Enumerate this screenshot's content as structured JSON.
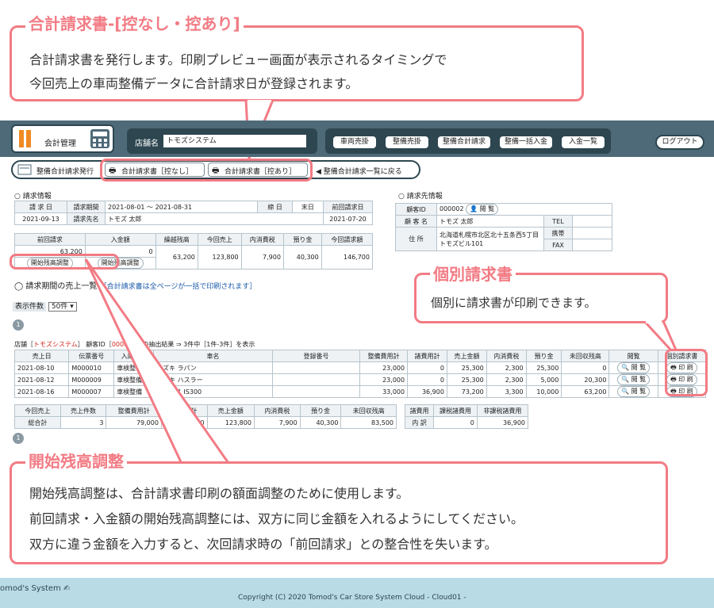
{
  "callout_top": {
    "title": "合計請求書-[控なし・控あり]",
    "line1": "合計請求書を発行します。印刷プレビュー画面が表示されるタイミングで",
    "line2": "今回売上の車両整備データに合計請求日が登録されます。"
  },
  "callout_mid": {
    "title": "個別請求書",
    "line1": "個別に請求書が印刷できます。"
  },
  "callout_bottom": {
    "title": "開始残高調整",
    "line1": "開始残高調整は、合計請求書印刷の額面調整のために使用します。",
    "line2": "前回請求・入金額の開始残高調整には、双方に同じ金額を入れるようにしてください。",
    "line3": "双方に違う金額を入力すると、次回請求時の「前回請求」との整合性を失います。"
  },
  "header": {
    "app_label": "会計管理",
    "store_label": "店舗名",
    "store_value": "トモズシステム",
    "nav": [
      "車両売掛",
      "整備売掛",
      "整備合計請求",
      "整備一括入金",
      "入金一覧"
    ],
    "logout": "ログアウト"
  },
  "toolbar": {
    "issue": "整備合計請求発行",
    "print_no_copy": "合計請求書［控なし］",
    "print_with_copy": "合計請求書［控あり］",
    "back": "整備合計請求一覧に戻る"
  },
  "billing": {
    "section": "請求情報",
    "h_date": "請 求 日",
    "date": "2021-09-13",
    "h_period": "請求期間",
    "period": "2021-08-01 ～ 2021-08-31",
    "h_cutoff": "締 日",
    "cutoff": "末日",
    "h_customer": "請求先名",
    "customer": "トモズ 太郎",
    "h_prev_date": "前回請求日",
    "prev_date": "2021-07-20",
    "sum_headers": [
      "前回請求",
      "入金額",
      "繰越残高",
      "今回売上",
      "内消費税",
      "預り金",
      "今回請求額"
    ],
    "prev_bill": "63,200",
    "deposit": "0",
    "carry": "63,200",
    "sales": "123,800",
    "tax": "7,900",
    "held": "40,300",
    "bill_total": "146,700",
    "adjust1": "開始残高調整",
    "adjust2": "開始残高調整"
  },
  "dest": {
    "section": "請求先情報",
    "h_id": "顧客ID",
    "id": "000002",
    "view": "閲 覧",
    "h_name": "顧 客 名",
    "name": "トモズ 太郎",
    "h_addr": "住 所",
    "addr1": "北海道札幌市北区北十五条西5丁目",
    "addr2": "トモズビル101",
    "tel": "TEL",
    "mobile": "携帯",
    "fax": "FAX"
  },
  "list": {
    "title": "請求期間の売上一覧",
    "note": "［合計請求書は全ページが一括で印刷されます］",
    "count_label": "表示件数",
    "count_value": "50件",
    "page": "1",
    "filter_prefix": "店舗［",
    "filter_store": "トモズシステム",
    "filter_mid": "］ 顧客ID［",
    "filter_id": "000002",
    "filter_suffix": "］の抽出結果 ⇒ 3件中［1件-3件］を表示",
    "headers": [
      "売上日",
      "伝票番号",
      "入庫区分",
      "車名",
      "登録番号",
      "整備費用計",
      "諸費用計",
      "売上金額",
      "内消費税",
      "預り金",
      "未回収残高",
      "閲覧",
      "個別請求書"
    ],
    "view_label": "閲 覧",
    "print_label": "印 刷",
    "rows": [
      {
        "date": "2021-08-10",
        "no": "M000010",
        "kind": "車検整備",
        "car": "スズキ ラパン",
        "reg": "",
        "maint": "23,000",
        "misc": "0",
        "sales": "25,300",
        "tax": "2,300",
        "held": "25,300",
        "unpaid": "0"
      },
      {
        "date": "2021-08-12",
        "no": "M000009",
        "kind": "車検整備",
        "car": "スズキ ハスラー",
        "reg": "",
        "maint": "23,000",
        "misc": "0",
        "sales": "25,300",
        "tax": "2,300",
        "held": "5,000",
        "unpaid": "20,300"
      },
      {
        "date": "2021-08-16",
        "no": "M000007",
        "kind": "車検整備",
        "car": "レクサス IS300",
        "reg": "",
        "maint": "33,000",
        "misc": "36,900",
        "sales": "73,200",
        "tax": "3,300",
        "held": "10,000",
        "unpaid": "63,200"
      }
    ]
  },
  "totals": {
    "h_left1": "今回売上",
    "h_left2": "総合計",
    "headers": [
      "売上件数",
      "整備費用計",
      "諸費用計",
      "売上金額",
      "内消費税",
      "預り金",
      "未回収残高"
    ],
    "values": [
      "3",
      "79,000",
      "36,900",
      "123,800",
      "7,900",
      "40,300",
      "83,500"
    ],
    "misc_h1": "諸費用",
    "misc_h2": "内 訳",
    "misc_headers": [
      "課税諸費用",
      "非課税諸費用"
    ],
    "misc_values": [
      "0",
      "36,900"
    ],
    "page": "1"
  },
  "footer": {
    "logo": "omod's System",
    "copyright": "Copyright (C) 2020 Tomod's Car Store System Cloud - Cloud01 -"
  }
}
